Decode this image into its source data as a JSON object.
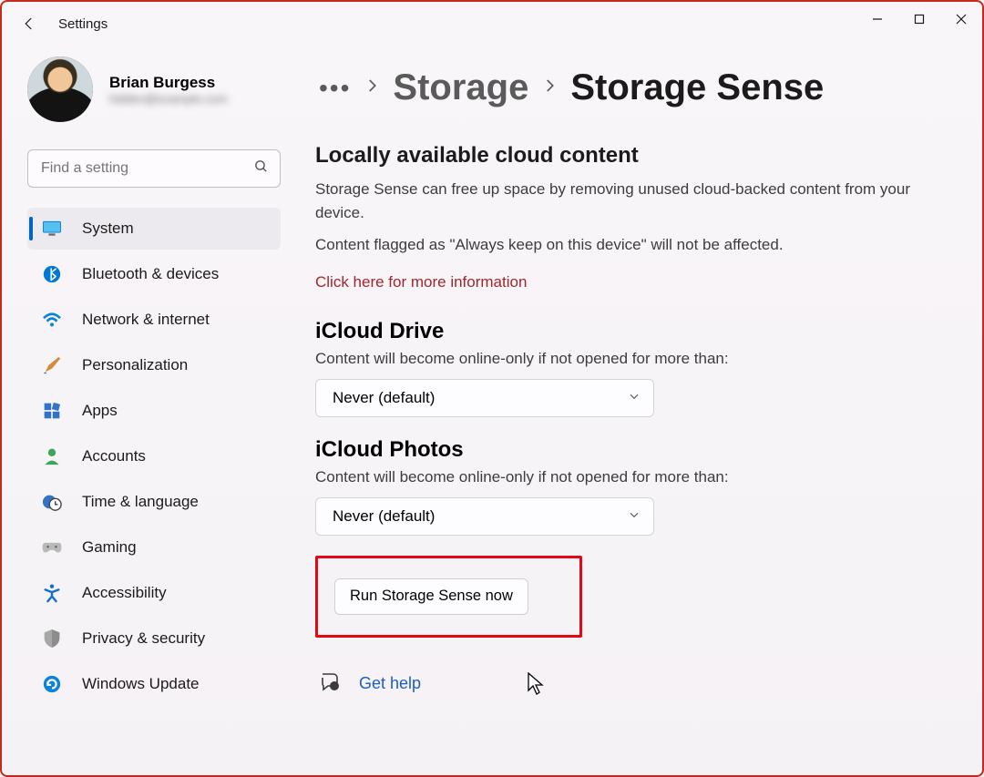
{
  "window": {
    "title": "Settings"
  },
  "profile": {
    "name": "Brian Burgess",
    "email": "hidden@example.com"
  },
  "search": {
    "placeholder": "Find a setting"
  },
  "sidebar": {
    "items": [
      {
        "label": "System",
        "icon": "monitor-icon",
        "active": true
      },
      {
        "label": "Bluetooth & devices",
        "icon": "bluetooth-icon"
      },
      {
        "label": "Network & internet",
        "icon": "wifi-icon"
      },
      {
        "label": "Personalization",
        "icon": "paintbrush-icon"
      },
      {
        "label": "Apps",
        "icon": "apps-icon"
      },
      {
        "label": "Accounts",
        "icon": "person-icon"
      },
      {
        "label": "Time & language",
        "icon": "clock-globe-icon"
      },
      {
        "label": "Gaming",
        "icon": "controller-icon"
      },
      {
        "label": "Accessibility",
        "icon": "accessibility-icon"
      },
      {
        "label": "Privacy & security",
        "icon": "shield-icon"
      },
      {
        "label": "Windows Update",
        "icon": "update-icon"
      }
    ]
  },
  "breadcrumb": {
    "ellipsis": "•••",
    "parent": "Storage",
    "current": "Storage Sense"
  },
  "cloud": {
    "heading": "Locally available cloud content",
    "line1": "Storage Sense can free up space by removing unused cloud-backed content from your device.",
    "line2": "Content flagged as \"Always keep on this device\" will not be affected.",
    "link": "Click here for more information"
  },
  "icloud_drive": {
    "heading": "iCloud Drive",
    "caption": "Content will become online-only if not opened for more than:",
    "selected": "Never (default)"
  },
  "icloud_photos": {
    "heading": "iCloud Photos",
    "caption": "Content will become online-only if not opened for more than:",
    "selected": "Never (default)"
  },
  "run_button": "Run Storage Sense now",
  "help": {
    "label": "Get help"
  },
  "colors": {
    "accent": "#0067c0",
    "danger": "#a3262c",
    "highlight": "#e30613"
  }
}
